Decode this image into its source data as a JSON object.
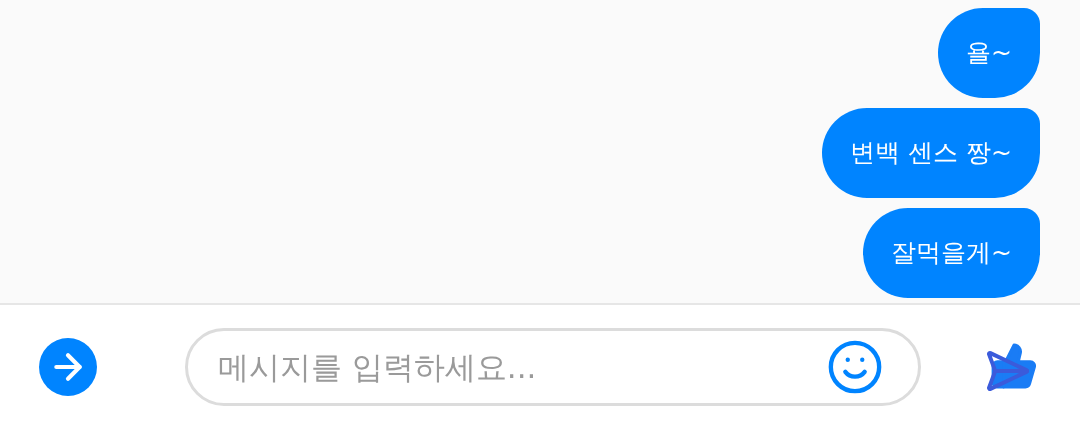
{
  "messages": [
    {
      "text": "욜~"
    },
    {
      "text": "변백 센스 짱~"
    },
    {
      "text": "잘먹을게~"
    }
  ],
  "composer": {
    "placeholder": "메시지를 입력하세요..."
  }
}
